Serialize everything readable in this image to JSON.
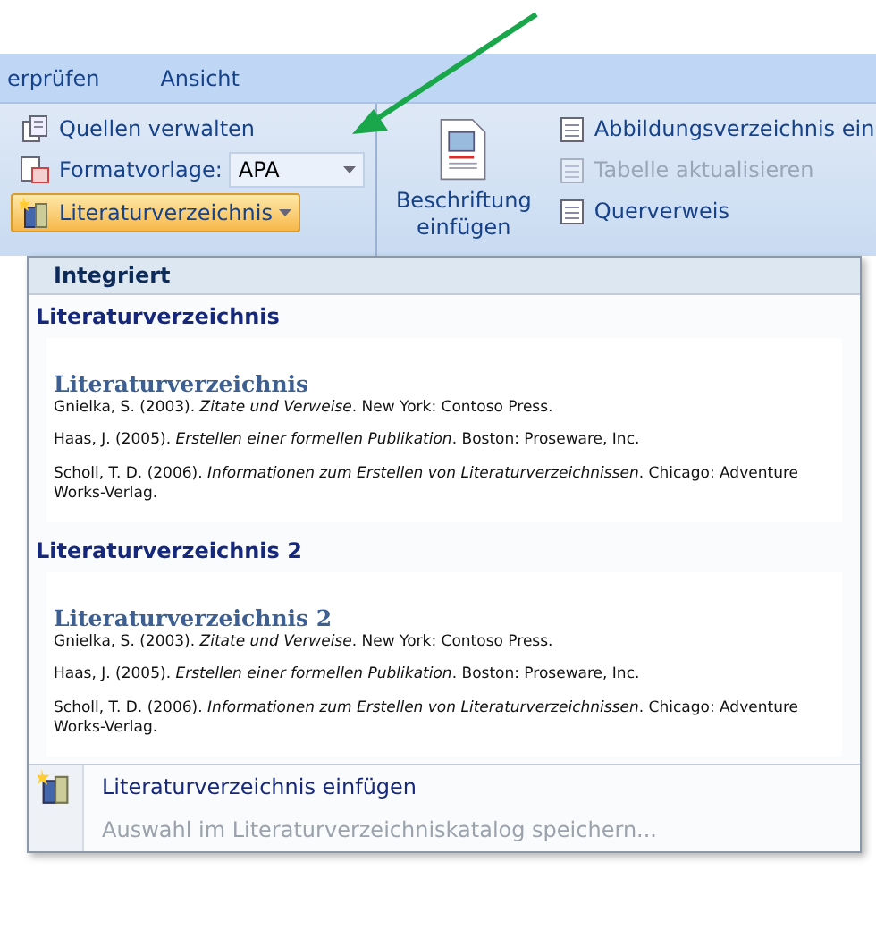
{
  "tabs": [
    "erprüfen",
    "Ansicht"
  ],
  "citations_group": {
    "manage_sources": {
      "label": "Quellen verwalten"
    },
    "style": {
      "label": "Formatvorlage:",
      "value": "APA"
    },
    "bibliography": {
      "label": "Literaturverzeichnis",
      "pressed": true
    }
  },
  "captions_group": {
    "insert_caption": "Beschriftung einfügen",
    "commands": [
      {
        "label": "Abbildungsverzeichnis ein",
        "disabled": false
      },
      {
        "label": "Tabelle aktualisieren",
        "disabled": true
      },
      {
        "label": "Querverweis",
        "disabled": false
      }
    ]
  },
  "menu": {
    "header": "Integriert",
    "gallery": [
      {
        "title": "Literaturverzeichnis",
        "preview_heading": "Literaturverzeichnis",
        "entries": [
          "Gnielka, S. (2003). *Zitate und Verweise*. New York: Contoso Press.",
          "Haas, J. (2005). *Erstellen einer formellen Publikation*. Boston: Proseware, Inc.",
          "Scholl, T. D. (2006). *Informationen zum Erstellen von Literaturverzeichnissen*. Chicago: Adventure Works-Verlag."
        ]
      },
      {
        "title": "Literaturverzeichnis 2",
        "preview_heading": "Literaturverzeichnis 2",
        "entries": [
          "Gnielka, S. (2003). *Zitate und Verweise*. New York: Contoso Press.",
          "Haas, J. (2005). *Erstellen einer formellen Publikation*. Boston: Proseware, Inc.",
          "Scholl, T. D. (2006). *Informationen zum Erstellen von Literaturverzeichnissen*. Chicago: Adventure Works-Verlag."
        ]
      }
    ],
    "commands": [
      {
        "label": "Literaturverzeichnis einfügen",
        "disabled": false
      },
      {
        "label": "Auswahl im Literaturverzeichniskatalog speichern...",
        "disabled": true
      }
    ]
  }
}
